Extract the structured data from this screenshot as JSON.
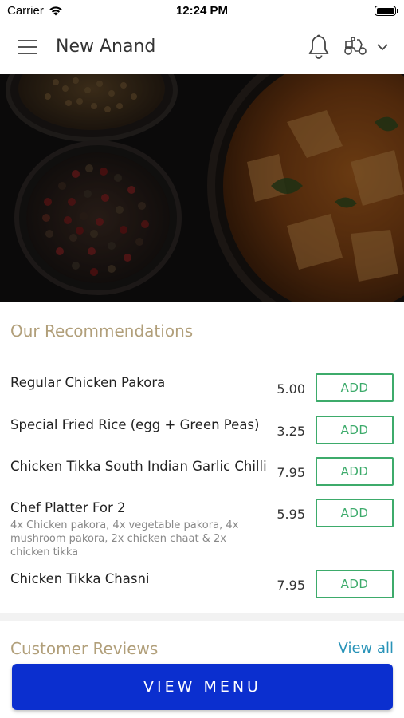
{
  "status_bar": {
    "carrier": "Carrier",
    "time": "12:24 PM"
  },
  "header": {
    "title": "New Anand",
    "icons": [
      "menu-icon",
      "bell-icon",
      "scooter-delivery-icon",
      "chevron-down-icon"
    ]
  },
  "hero": {
    "description_icon": "food-hero-image"
  },
  "recommendations": {
    "title": "Our Recommendations",
    "add_label": "ADD",
    "items": [
      {
        "name": "Regular Chicken Pakora",
        "price": "5.00",
        "description": ""
      },
      {
        "name": "Special Fried Rice (egg + Green Peas)",
        "price": "3.25",
        "description": ""
      },
      {
        "name": "Chicken Tikka South Indian Garlic Chilli",
        "price": "7.95",
        "description": ""
      },
      {
        "name": "Chef Platter For 2",
        "price": "5.95",
        "description": "4x Chicken pakora, 4x vegetable pakora, 4x mushroom pakora, 2x chicken chaat & 2x chicken tikka"
      },
      {
        "name": "Chicken Tikka Chasni",
        "price": "7.95",
        "description": ""
      }
    ]
  },
  "reviews": {
    "title": "Customer Reviews",
    "view_all": "View all"
  },
  "footer": {
    "view_menu": "VIEW MENU"
  },
  "colors": {
    "accent_gold": "#b19f7a",
    "add_green": "#3dab6b",
    "link_blue": "#2893b8",
    "primary_button": "#0b2fcf"
  }
}
